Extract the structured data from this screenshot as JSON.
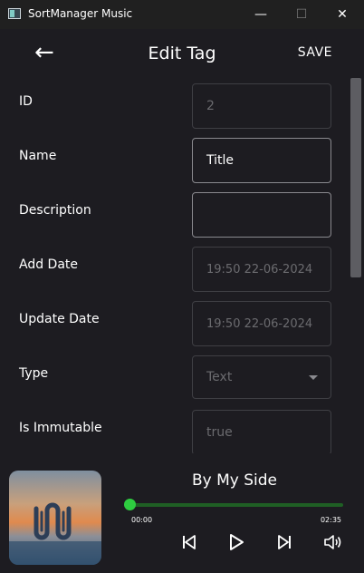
{
  "window": {
    "title": "SortManager Music",
    "app_icon": "app-icon",
    "minimize_glyph": "—",
    "maximize_glyph": "☐",
    "close_glyph": "✕"
  },
  "appbar": {
    "back_glyph": "←",
    "title": "Edit Tag",
    "save_label": "SAVE"
  },
  "form": {
    "fields": [
      {
        "label": "ID",
        "value": "2",
        "state": "disabled"
      },
      {
        "label": "Name",
        "value": "Title",
        "state": "active"
      },
      {
        "label": "Description",
        "value": "",
        "state": "active"
      },
      {
        "label": "Add Date",
        "value": "19:50 22-06-2024",
        "state": "disabled"
      },
      {
        "label": "Update Date",
        "value": "19:50 22-06-2024",
        "state": "disabled"
      },
      {
        "label": "Type",
        "value": "Text",
        "state": "disabled",
        "dropdown": true
      },
      {
        "label": "Is Immutable",
        "value": "true",
        "state": "disabled"
      }
    ]
  },
  "player": {
    "track_title": "By My Side",
    "elapsed": "00:00",
    "duration": "02:35",
    "progress_fraction": 0.0,
    "accent_color": "#2ecc40",
    "icons": [
      "skip-previous-icon",
      "play-icon",
      "skip-next-icon",
      "volume-icon"
    ]
  }
}
